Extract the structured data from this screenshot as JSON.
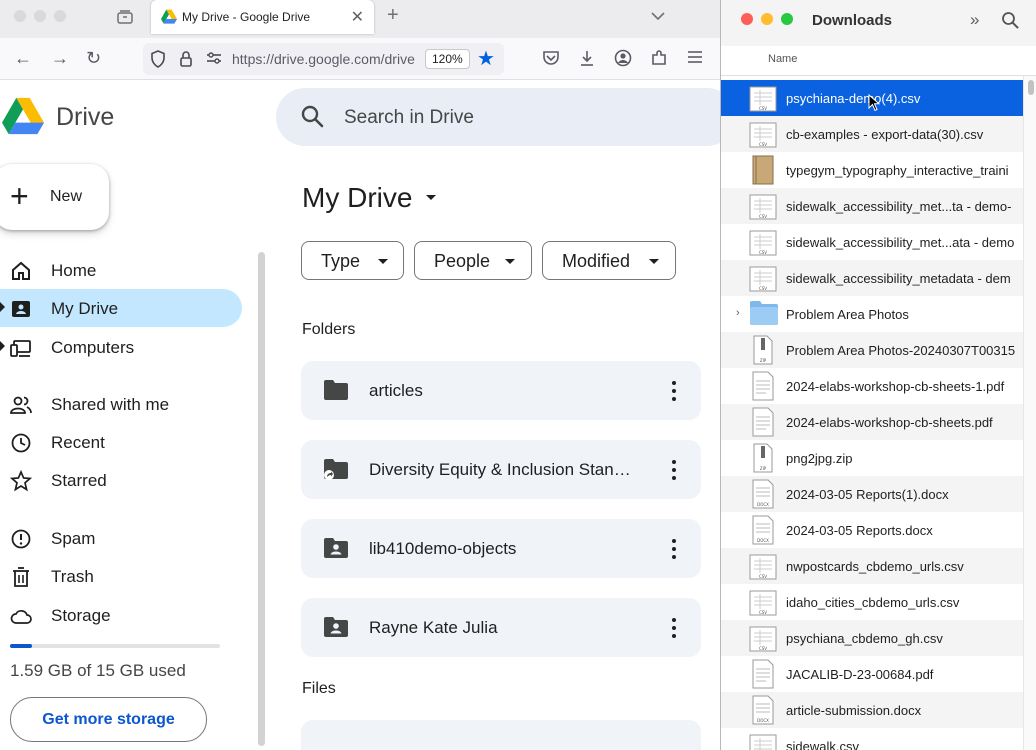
{
  "browser": {
    "tab_title": "My Drive - Google Drive",
    "url": "https://drive.google.com/drive",
    "zoom": "120%"
  },
  "drive": {
    "app_name": "Drive",
    "search_placeholder": "Search in Drive",
    "new_label": "New",
    "nav": [
      {
        "label": "Home",
        "icon": "home-icon"
      },
      {
        "label": "My Drive",
        "icon": "my-drive-icon",
        "active": true
      },
      {
        "label": "Computers",
        "icon": "computers-icon"
      },
      {
        "label": "Shared with me",
        "icon": "shared-icon"
      },
      {
        "label": "Recent",
        "icon": "recent-icon"
      },
      {
        "label": "Starred",
        "icon": "star-icon"
      },
      {
        "label": "Spam",
        "icon": "spam-icon"
      },
      {
        "label": "Trash",
        "icon": "trash-icon"
      },
      {
        "label": "Storage",
        "icon": "cloud-icon"
      }
    ],
    "storage_used_fraction": 0.106,
    "storage_text": "1.59 GB of 15 GB used",
    "get_more_storage": "Get more storage",
    "title": "My Drive",
    "filters": [
      "Type",
      "People",
      "Modified"
    ],
    "folders_label": "Folders",
    "folders": [
      {
        "name": "articles",
        "icon": "folder-icon"
      },
      {
        "name": "Diversity Equity & Inclusion Stan…",
        "icon": "shortcut-folder-icon"
      },
      {
        "name": "lib410demo-objects",
        "icon": "shared-folder-icon"
      },
      {
        "name": "Rayne Kate Julia",
        "icon": "shared-folder-icon"
      }
    ],
    "files_label": "Files"
  },
  "finder": {
    "title": "Downloads",
    "column_header": "Name",
    "files": [
      {
        "name": "psychiana-demo(4).csv",
        "type": "csv",
        "selected": true
      },
      {
        "name": "cb-examples - export-data(30).csv",
        "type": "csv"
      },
      {
        "name": "typegym_typography_interactive_traini",
        "type": "book"
      },
      {
        "name": "sidewalk_accessibility_met...ta - demo-",
        "type": "csv"
      },
      {
        "name": "sidewalk_accessibility_met...ata - demo",
        "type": "csv"
      },
      {
        "name": "sidewalk_accessibility_metadata - dem",
        "type": "csv"
      },
      {
        "name": "Problem Area Photos",
        "type": "folder"
      },
      {
        "name": "Problem Area Photos-20240307T00315",
        "type": "zip"
      },
      {
        "name": "2024-elabs-workshop-cb-sheets-1.pdf",
        "type": "pdf"
      },
      {
        "name": "2024-elabs-workshop-cb-sheets.pdf",
        "type": "pdf"
      },
      {
        "name": "png2jpg.zip",
        "type": "zip"
      },
      {
        "name": "2024-03-05 Reports(1).docx",
        "type": "docx"
      },
      {
        "name": "2024-03-05 Reports.docx",
        "type": "docx"
      },
      {
        "name": "nwpostcards_cbdemo_urls.csv",
        "type": "csv"
      },
      {
        "name": "idaho_cities_cbdemo_urls.csv",
        "type": "csv"
      },
      {
        "name": "psychiana_cbdemo_gh.csv",
        "type": "csv"
      },
      {
        "name": "JACALIB-D-23-00684.pdf",
        "type": "pdf"
      },
      {
        "name": "article-submission.docx",
        "type": "docx"
      },
      {
        "name": "sidewalk.csv",
        "type": "csv"
      }
    ]
  },
  "colors": {
    "drive_accent": "#0b57d0",
    "nav_active": "#c2e7ff",
    "finder_selection": "#0a62e0"
  }
}
